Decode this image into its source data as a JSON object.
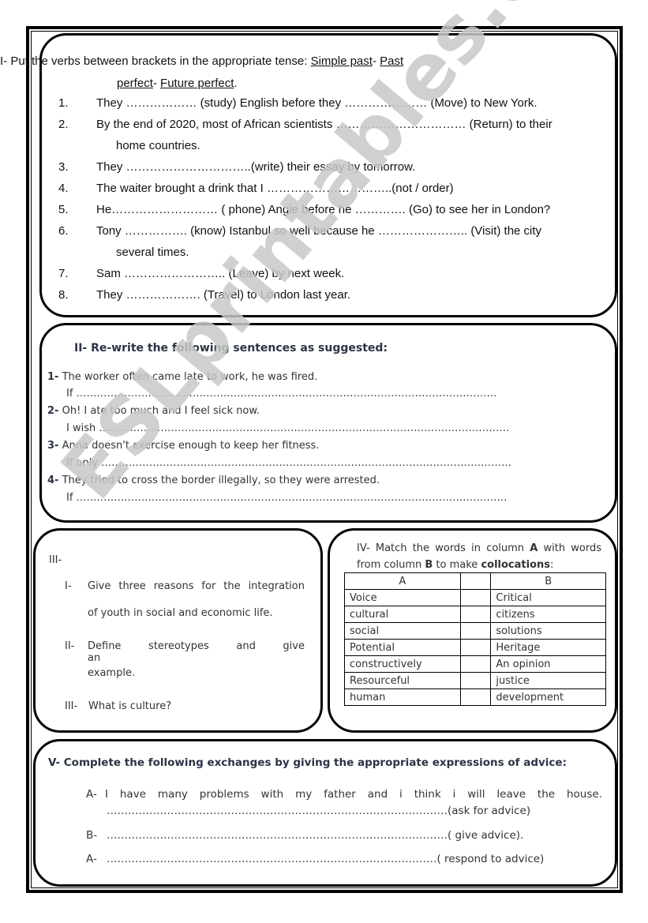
{
  "section1": {
    "heading_prefix": "I-  Put the verbs between brackets in the appropriate tense: ",
    "tense1": "Simple past",
    "sep1": "- ",
    "tense2a": "Past",
    "tense2b": "perfect",
    "sep2": "- ",
    "tense3": "Future perfect",
    "end": ".",
    "items": [
      {
        "num": "1.",
        "text": "They ……………… (study) English before they ………………… (Move) to New York."
      },
      {
        "num": "2.",
        "text": "By the end of 2020, most of African scientists …………………………… (Return) to their",
        "cont": "home countries."
      },
      {
        "num": "3.",
        "text": "They …………………………..(write) their essay by tomorrow."
      },
      {
        "num": "4.",
        "text": "The waiter brought a drink that I …………………………..(not / order)"
      },
      {
        "num": "5.",
        "text": "He……………………… ( phone) Angie before he …………. (Go)  to see her in London?"
      },
      {
        "num": "6.",
        "text": "Tony ……………. (know) Istanbul so well because he ………………….. (Visit) the city",
        "cont": "several times."
      },
      {
        "num": "7.",
        "text": "Sam …………………….. (Leave) by next week."
      },
      {
        "num": "8.",
        "text": "They ………………. (Travel) to London last year."
      }
    ]
  },
  "section2": {
    "heading": "II- Re-write the following sentences as suggested:",
    "items": [
      {
        "num": "1-",
        "sentence": "The worker often came late to work, he was fired.",
        "prompt": "If ……………………………………………………………………………………………………………"
      },
      {
        "num": "2-",
        "sentence": "Oh! I ate too much and I feel sick now.",
        "prompt": "I wish …………………………………………………………………………………………………………"
      },
      {
        "num": "3-",
        "sentence": "Anna doesn't exercise enough to keep her fitness.",
        "prompt": "If only …………………………………………………………………………………………………………"
      },
      {
        "num": "4-",
        "sentence": "They tried to cross the border illegally, so they were arrested.",
        "prompt": "If ………………………………………………………………………………………………………………"
      }
    ]
  },
  "section3": {
    "heading": "III-",
    "items": [
      {
        "num": "I-",
        "line1": "Give three reasons for the integration",
        "line2": "of youth in social and economic life."
      },
      {
        "num": "II-",
        "line1": "Define stereotypes and give an",
        "line2": "example."
      },
      {
        "num": "III-",
        "line1": "What is culture?"
      }
    ]
  },
  "section4": {
    "heading_part1": "IV- Match the words in column ",
    "colA_bold": "A",
    "heading_part2": " with words from column ",
    "colB_bold": "B",
    "heading_part3": " to make ",
    "collocations_bold": "collocations",
    "heading_end": ":",
    "table": {
      "headers": [
        "A",
        "",
        "B"
      ],
      "rows": [
        [
          "Voice",
          "",
          "Critical"
        ],
        [
          "cultural",
          "",
          "citizens"
        ],
        [
          "social",
          "",
          "solutions"
        ],
        [
          "Potential",
          "",
          "Heritage"
        ],
        [
          "constructively",
          "",
          "An opinion"
        ],
        [
          "Resourceful",
          "",
          "justice"
        ],
        [
          "human",
          "",
          "development"
        ]
      ]
    }
  },
  "section5": {
    "heading": "V- Complete the following exchanges by giving the appropriate expressions of advice:",
    "lines": [
      {
        "speaker": "A-",
        "text": "I have many problems with my father and i think i will leave the house.",
        "cont": "……………………………………………………………………………………(ask for advice)"
      },
      {
        "speaker": "B-",
        "text": "……………………………………………………………………………………( give advice)."
      },
      {
        "speaker": "A-",
        "text": "…………………………………………………………………………………( respond to advice)"
      }
    ]
  },
  "watermark": "ESLprintables.com"
}
